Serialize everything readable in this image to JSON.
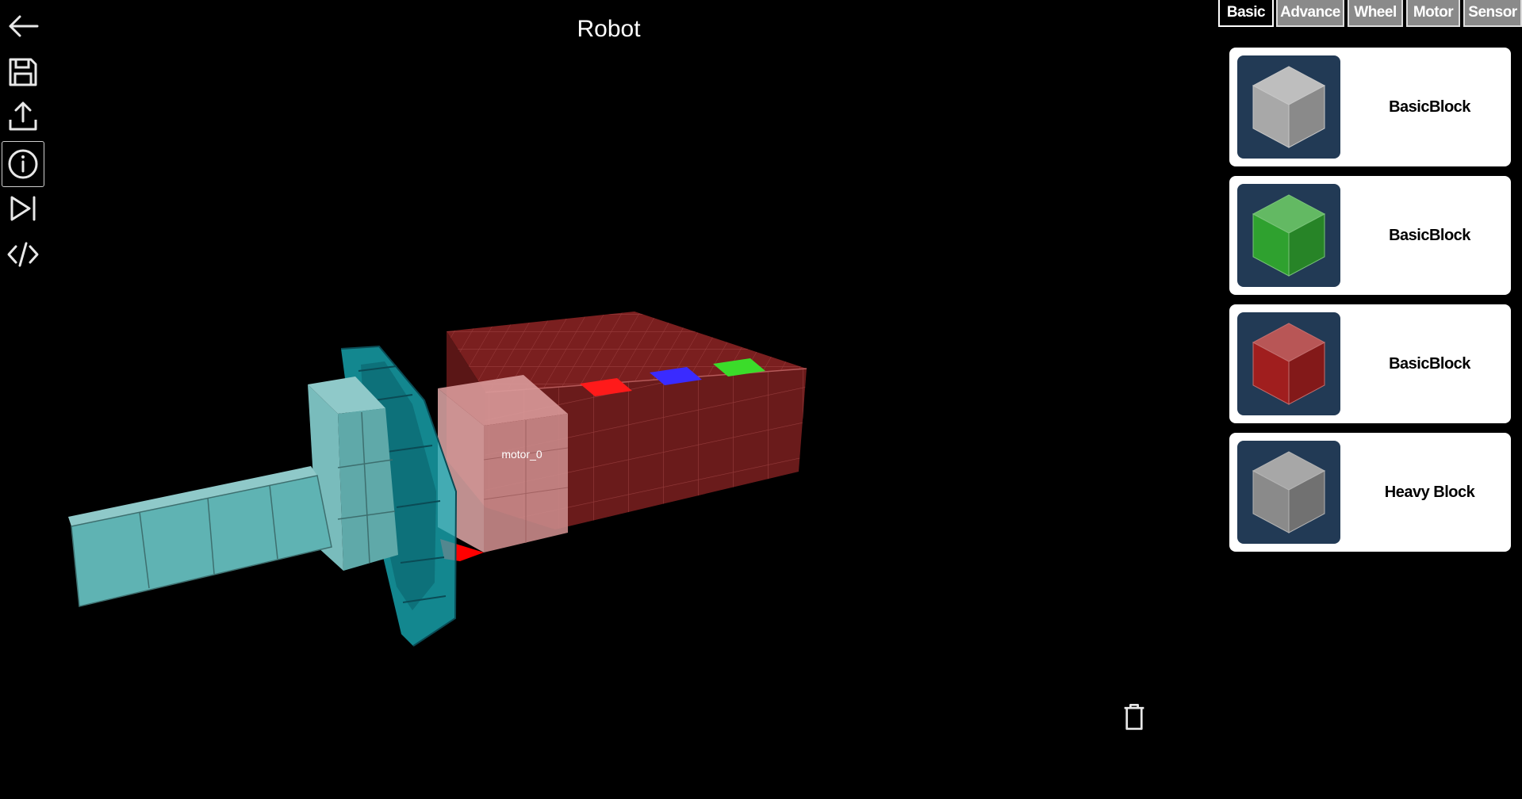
{
  "app": {
    "title": "Robot"
  },
  "toolbar": {
    "items": [
      {
        "name": "back",
        "icon": "arrow-left-icon"
      },
      {
        "name": "save",
        "icon": "floppy-disk-icon"
      },
      {
        "name": "upload",
        "icon": "upload-icon"
      },
      {
        "name": "info",
        "icon": "info-circle-icon",
        "active": true
      },
      {
        "name": "play",
        "icon": "step-forward-icon"
      },
      {
        "name": "code",
        "icon": "code-icon"
      }
    ]
  },
  "viewport": {
    "motor_label": "motor_0",
    "colors": {
      "body": "#7a1e1e",
      "wheel": "#16b5c2",
      "shaft": "#5fb3b3"
    },
    "markers": [
      "#ff1a1a",
      "#3a2bff",
      "#3bdc2a"
    ]
  },
  "tabs": [
    {
      "label": "Basic",
      "active": true
    },
    {
      "label": "Advance"
    },
    {
      "label": "Wheel"
    },
    {
      "label": "Motor"
    },
    {
      "label": "Sensor"
    }
  ],
  "palette": [
    {
      "label": "BasicBlock",
      "color": "#a8a8a8"
    },
    {
      "label": "BasicBlock",
      "color": "#2fa12f"
    },
    {
      "label": "BasicBlock",
      "color": "#a01e1e"
    },
    {
      "label": "Heavy Block",
      "color": "#8a8a8a"
    }
  ],
  "trash": {
    "icon": "trash-icon"
  }
}
